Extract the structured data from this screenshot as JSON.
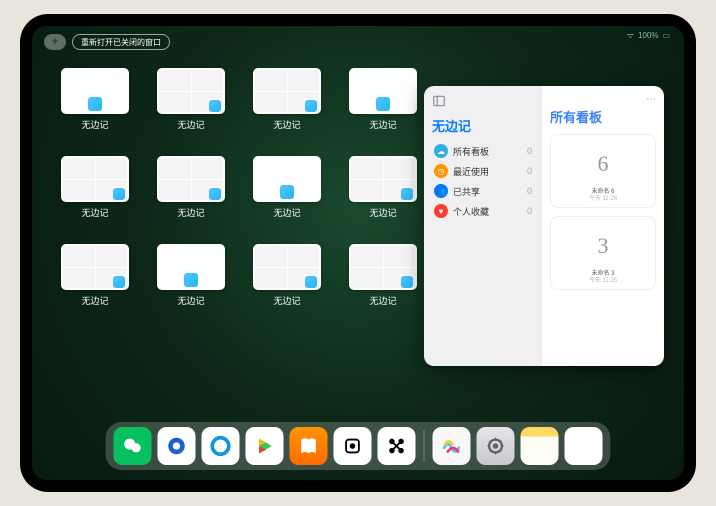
{
  "status": {
    "battery": "100%",
    "signal": "Wi-Fi"
  },
  "top": {
    "plus": "+",
    "reopen_label": "重新打开已关闭的窗口"
  },
  "grid": {
    "app_label": "无边记",
    "tiles": [
      {
        "variant": "blank"
      },
      {
        "variant": "list"
      },
      {
        "variant": "list"
      },
      {
        "variant": "blank"
      },
      {
        "variant": "list"
      },
      {
        "variant": "list"
      },
      {
        "variant": "blank"
      },
      {
        "variant": "list"
      },
      {
        "variant": "list"
      },
      {
        "variant": "blank"
      },
      {
        "variant": "list"
      },
      {
        "variant": "list"
      }
    ]
  },
  "panel": {
    "left_title": "无边记",
    "right_title": "所有看板",
    "items": [
      {
        "icon": "cloud",
        "color": "#32ade6",
        "label": "所有看板",
        "count": "0"
      },
      {
        "icon": "clock",
        "color": "#ff9500",
        "label": "最近使用",
        "count": "0"
      },
      {
        "icon": "people",
        "color": "#007aff",
        "label": "已共享",
        "count": "0"
      },
      {
        "icon": "heart",
        "color": "#ff3b30",
        "label": "个人收藏",
        "count": "0"
      }
    ],
    "boards": [
      {
        "drawing": "6",
        "title": "未命名 6",
        "subtitle": "今天 11:28"
      },
      {
        "drawing": "3",
        "title": "未命名 3",
        "subtitle": "今天 11:25"
      }
    ]
  },
  "dock": {
    "items": [
      {
        "name": "wechat-icon"
      },
      {
        "name": "uc-browser-icon"
      },
      {
        "name": "qq-browser-icon"
      },
      {
        "name": "play-icon"
      },
      {
        "name": "books-icon"
      },
      {
        "name": "dice-icon"
      },
      {
        "name": "connect-icon"
      },
      {
        "name": "freeform-icon"
      },
      {
        "name": "settings-icon"
      },
      {
        "name": "notes-icon"
      },
      {
        "name": "recent-apps-icon"
      }
    ]
  }
}
